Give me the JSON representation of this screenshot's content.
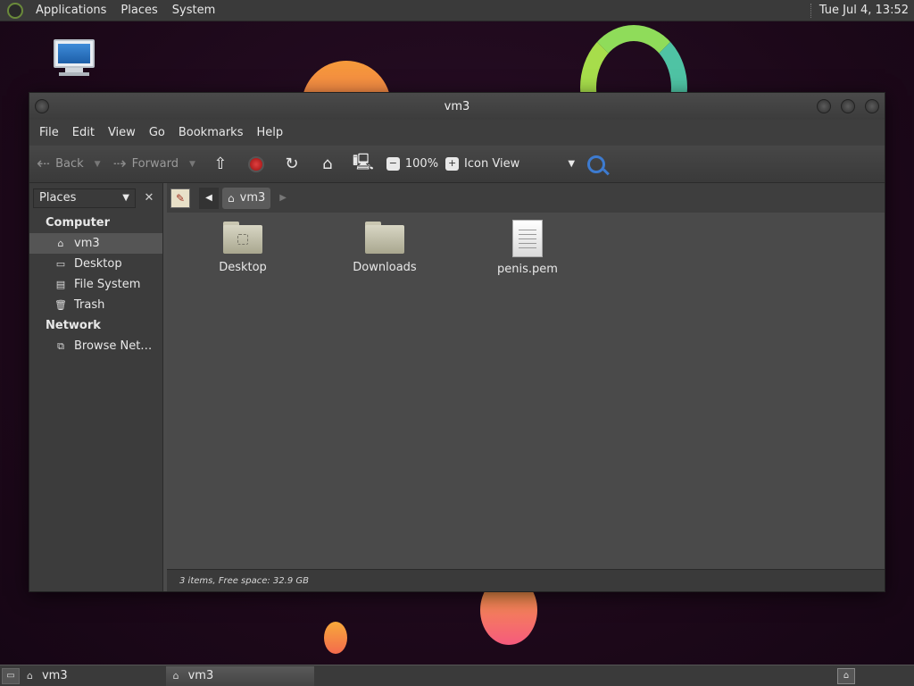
{
  "top_panel": {
    "menus": [
      "Applications",
      "Places",
      "System"
    ],
    "clock": "Tue Jul  4, 13:52"
  },
  "window": {
    "title": "vm3",
    "menubar": [
      "File",
      "Edit",
      "View",
      "Go",
      "Bookmarks",
      "Help"
    ],
    "toolbar": {
      "back": "Back",
      "forward": "Forward",
      "zoom": "100%",
      "view_mode": "Icon View"
    },
    "sidebar": {
      "selector": "Places",
      "sections": [
        {
          "heading": "Computer",
          "items": [
            {
              "label": "vm3",
              "icon": "home-icon",
              "selected": true
            },
            {
              "label": "Desktop",
              "icon": "desktop-icon",
              "selected": false
            },
            {
              "label": "File System",
              "icon": "drive-icon",
              "selected": false
            },
            {
              "label": "Trash",
              "icon": "trash-icon",
              "selected": false
            }
          ]
        },
        {
          "heading": "Network",
          "items": [
            {
              "label": "Browse Net…",
              "icon": "network-icon",
              "selected": false
            }
          ]
        }
      ]
    },
    "pathbar": {
      "current": "vm3"
    },
    "files": [
      {
        "name": "Desktop",
        "type": "folder"
      },
      {
        "name": "Downloads",
        "type": "folder"
      },
      {
        "name": "penis.pem",
        "type": "document"
      }
    ],
    "status": "3 items, Free space: 32.9 GB"
  },
  "bottom_panel": {
    "tasks": [
      "vm3",
      "vm3"
    ]
  }
}
